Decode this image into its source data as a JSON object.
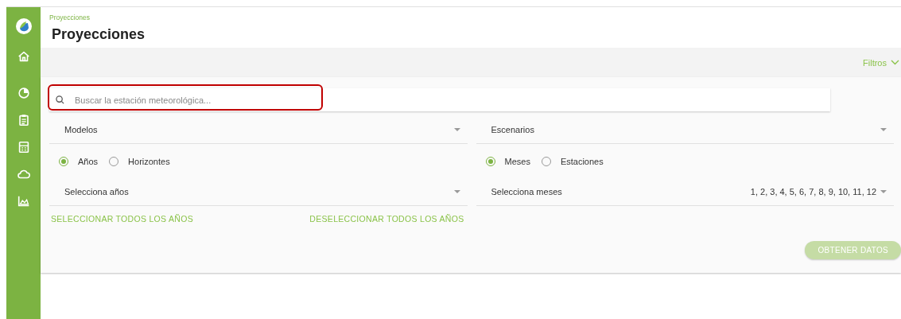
{
  "sidebar": {
    "items": [
      {
        "kind": "home",
        "selected": false
      },
      {
        "kind": "pie",
        "selected": false
      },
      {
        "kind": "clipboard",
        "selected": false
      },
      {
        "kind": "calculator",
        "selected": false
      },
      {
        "kind": "cloud",
        "selected": false
      },
      {
        "kind": "chart",
        "selected": false
      }
    ]
  },
  "breadcrumb": "Proyecciones",
  "title": "Proyecciones",
  "filter_bar": {
    "label": "Filtros",
    "expanded": true
  },
  "search": {
    "placeholder": "Buscar la estación meteorológica...",
    "highlighted": true
  },
  "columns": [
    {
      "select": {
        "label": "Modelos"
      },
      "radios": [
        {
          "label": "Años",
          "selected": true
        },
        {
          "label": "Horizontes",
          "selected": false
        }
      ],
      "multi": {
        "label": "Selecciona años"
      },
      "links": [
        "SELECCIONAR TODOS LOS AÑOS",
        "DESELECCIONAR TODOS LOS AÑOS"
      ]
    },
    {
      "select": {
        "label": "Escenarios"
      },
      "radios": [
        {
          "label": "Meses",
          "selected": true
        },
        {
          "label": "Estaciones",
          "selected": false
        }
      ],
      "multi": {
        "label": "Selecciona meses",
        "value": "1, 2, 3, 4, 5, 6, 7, 8, 9, 10, 11, 12"
      }
    }
  ],
  "submit": {
    "label": "OBTENER DATOS",
    "disabled": true
  }
}
